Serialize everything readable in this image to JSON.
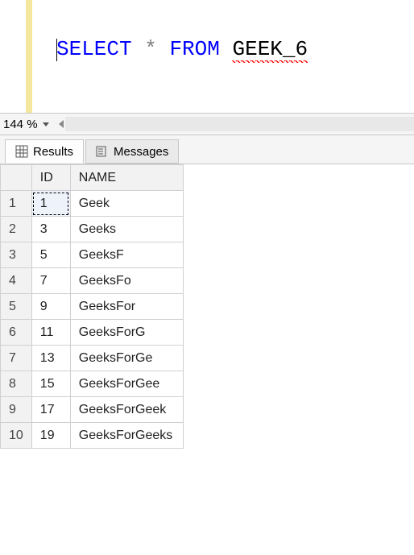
{
  "editor": {
    "sql": {
      "select": "SELECT",
      "star": "*",
      "from": "FROM",
      "table": "GEEK_6"
    }
  },
  "zoom": {
    "value": "144 %"
  },
  "tabs": {
    "results": "Results",
    "messages": "Messages"
  },
  "grid": {
    "columns": [
      "ID",
      "NAME"
    ],
    "rows": [
      {
        "n": "1",
        "id": "1",
        "name": "Geek"
      },
      {
        "n": "2",
        "id": "3",
        "name": "Geeks"
      },
      {
        "n": "3",
        "id": "5",
        "name": "GeeksF"
      },
      {
        "n": "4",
        "id": "7",
        "name": "GeeksFo"
      },
      {
        "n": "5",
        "id": "9",
        "name": "GeeksFor"
      },
      {
        "n": "6",
        "id": "11",
        "name": "GeeksForG"
      },
      {
        "n": "7",
        "id": "13",
        "name": "GeeksForGe"
      },
      {
        "n": "8",
        "id": "15",
        "name": "GeeksForGee"
      },
      {
        "n": "9",
        "id": "17",
        "name": "GeeksForGeek"
      },
      {
        "n": "10",
        "id": "19",
        "name": "GeeksForGeeks"
      }
    ]
  }
}
